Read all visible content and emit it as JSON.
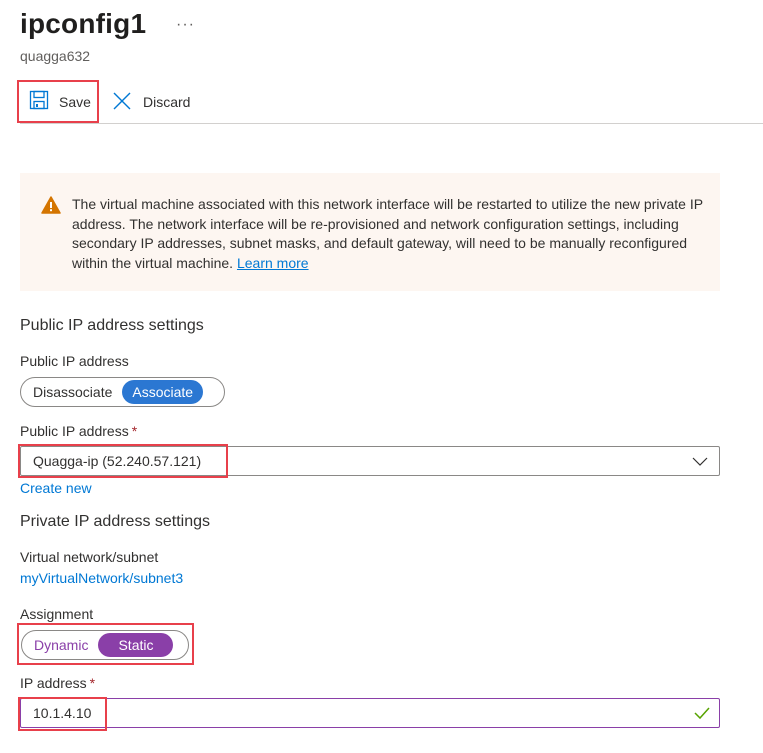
{
  "header": {
    "title": "ipconfig1",
    "more_label": "···",
    "subtitle": "quagga632"
  },
  "toolbar": {
    "save_label": "Save",
    "save_icon": "save-icon",
    "discard_label": "Discard",
    "discard_icon": "close-icon"
  },
  "warning": {
    "icon": "warning-icon",
    "text": "The virtual machine associated with this network interface will be restarted to utilize the new private IP address. The network interface will be re-provisioned and network configuration settings, including secondary IP addresses, subnet masks, and default gateway, will need to be manually reconfigured within the virtual machine.",
    "link_label": "Learn more"
  },
  "public_ip": {
    "section_title": "Public IP address settings",
    "toggle_label": "Public IP address",
    "toggle_options": [
      "Disassociate",
      "Associate"
    ],
    "toggle_selected": "Associate",
    "dropdown_label": "Public IP address",
    "required_mark": "*",
    "dropdown_value": "Quagga-ip (52.240.57.121)",
    "create_new_label": "Create new"
  },
  "private_ip": {
    "section_title": "Private IP address settings",
    "vnet_label": "Virtual network/subnet",
    "vnet_value": "myVirtualNetwork/subnet3",
    "assignment_label": "Assignment",
    "assignment_options": [
      "Dynamic",
      "Static"
    ],
    "assignment_selected": "Static",
    "ip_label": "IP address",
    "required_mark": "*",
    "ip_value": "10.1.4.10"
  },
  "colors": {
    "accent_blue": "#0078d4",
    "toggle_blue": "#2b77d2",
    "accent_purple": "#8a3fa8",
    "warning_orange": "#d47500",
    "highlight_red": "#e8404b",
    "valid_green": "#57a300"
  }
}
